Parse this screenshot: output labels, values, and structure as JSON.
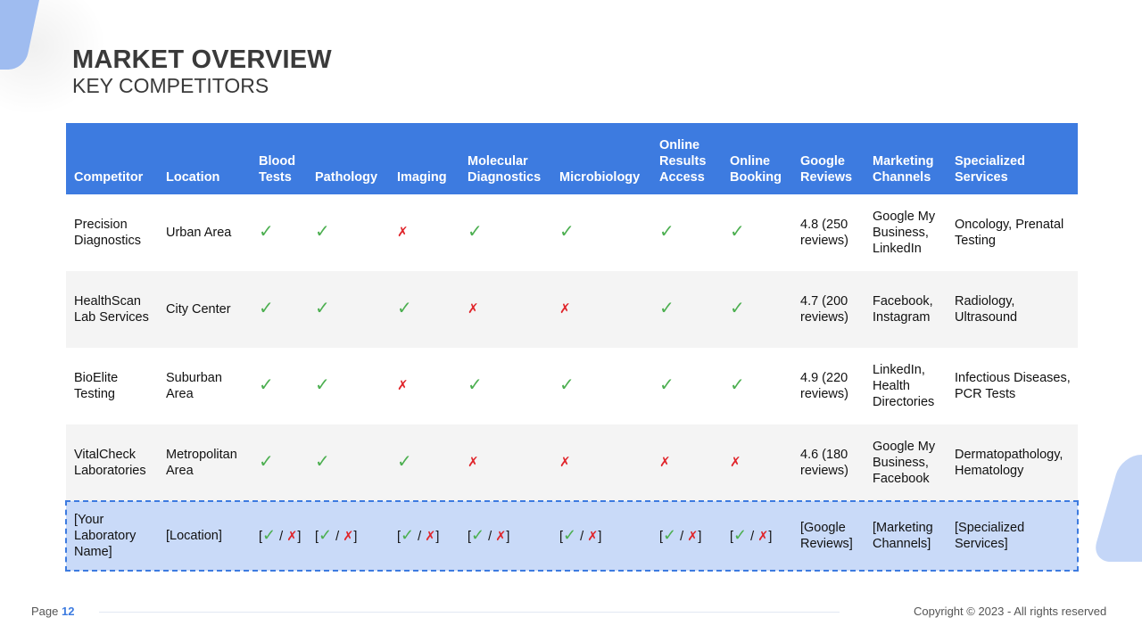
{
  "title": "MARKET OVERVIEW",
  "subtitle": "KEY COMPETITORS",
  "table": {
    "headers": {
      "competitor": "Competitor",
      "location": "Location",
      "blood": "Blood Tests",
      "pathology": "Pathology",
      "imaging": "Imaging",
      "molecular": "Molecular Diagnostics",
      "microbiology": "Microbiology",
      "online_results": "Online Results Access",
      "online_booking": "Online Booking",
      "google_reviews": "Google Reviews",
      "marketing": "Marketing Channels",
      "specialized": "Specialized Services"
    },
    "rows": [
      {
        "competitor": "Precision Diagnostics",
        "location": "Urban Area",
        "services": [
          "✓",
          "✓",
          "✗",
          "✓",
          "✓",
          "✓",
          "✓"
        ],
        "google_reviews": "4.8 (250 reviews)",
        "marketing": "Google My Business, LinkedIn",
        "specialized": "Oncology, Prenatal Testing"
      },
      {
        "competitor": "HealthScan Lab Services",
        "location": "City Center",
        "services": [
          "✓",
          "✓",
          "✓",
          "✗",
          "✗",
          "✓",
          "✓"
        ],
        "google_reviews": "4.7 (200 reviews)",
        "marketing": "Facebook, Instagram",
        "specialized": "Radiology, Ultrasound"
      },
      {
        "competitor": "BioElite Testing",
        "location": "Suburban Area",
        "services": [
          "✓",
          "✓",
          "✗",
          "✓",
          "✓",
          "✓",
          "✓"
        ],
        "google_reviews": "4.9 (220 reviews)",
        "marketing": "LinkedIn, Health Directories",
        "specialized": "Infectious Diseases, PCR Tests"
      },
      {
        "competitor": "VitalCheck Laboratories",
        "location": "Metropolitan Area",
        "services": [
          "✓",
          "✓",
          "✓",
          "✗",
          "✗",
          "✗",
          "✗"
        ],
        "google_reviews": "4.6 (180 reviews)",
        "marketing": "Google My Business, Facebook",
        "specialized": "Dermatopathology, Hematology"
      }
    ],
    "yours": {
      "competitor": "[Your Laboratory Name]",
      "location": "[Location]",
      "open": "[",
      "check": "✓",
      "slash": " / ",
      "cross": "✗",
      "close": "]",
      "google_reviews": "[Google Reviews]",
      "marketing": "[Marketing Channels]",
      "specialized": "[Specialized Services]"
    }
  },
  "footer": {
    "page_label": "Page",
    "page_number": "12",
    "copyright": "Copyright © 2023 - All rights reserved"
  },
  "colors": {
    "accent": "#3d7be0",
    "check": "#4caf50",
    "cross": "#e0242a",
    "highlight_row": "#c9daf8"
  }
}
